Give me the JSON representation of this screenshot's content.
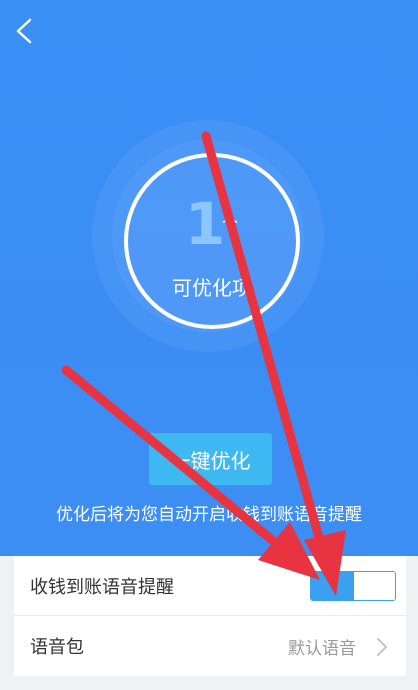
{
  "header": {
    "back_icon": "back-chevron-icon",
    "optimizable_count": "1",
    "count_unit": "个",
    "optimizable_label": "可优化项",
    "optimize_button_label": "一键优化",
    "optimize_hint": "优化后将为您自动开启收钱到账语音提醒"
  },
  "settings": {
    "voice_alert": {
      "label": "收钱到账语音提醒",
      "toggle_state": "off"
    },
    "voice_pack": {
      "label": "语音包",
      "value": "默认语音",
      "chevron_icon": "chevron-right-icon"
    }
  },
  "colors": {
    "header_blue": "#3b8df4",
    "button_blue": "#3db8f0",
    "toggle_blue": "#3aa0ef",
    "annotation_red": "#e83340",
    "card_bg": "#ffffff"
  },
  "annotations": {
    "arrow_count": 2,
    "arrow_icon": "red-annotation-arrow"
  }
}
